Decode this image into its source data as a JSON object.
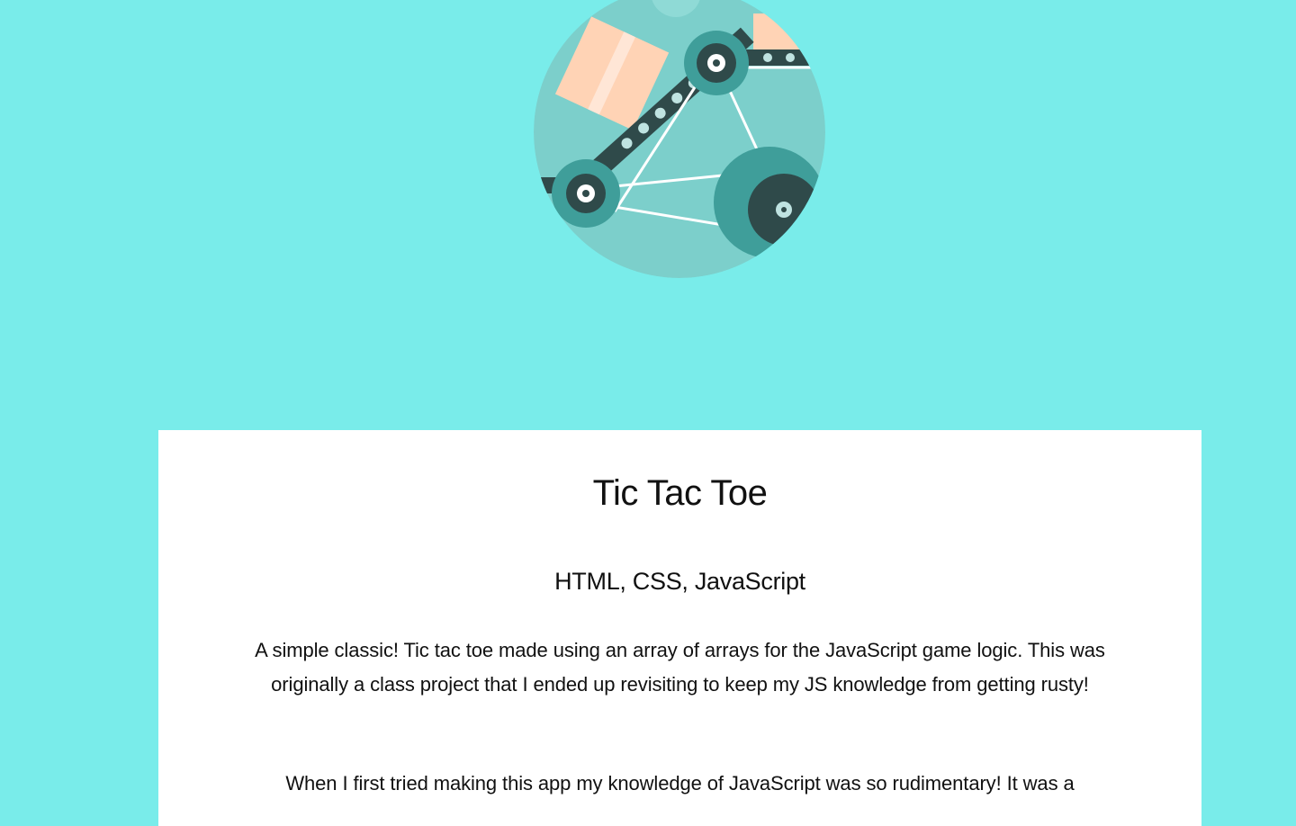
{
  "project": {
    "title": "Tic Tac Toe",
    "technologies": "HTML, CSS, JavaScript",
    "paragraphs": [
      "A simple classic! Tic tac toe made using an array of arrays for the JavaScript game logic. This was originally a class project that I ended up revisiting to keep my JS knowledge from getting rusty!",
      "When I first tried making this app my knowledge of JavaScript was so rudimentary! It was a"
    ]
  },
  "colors": {
    "page_background": "#79ecea",
    "card_background": "#ffffff",
    "text": "#111111",
    "illustration_bg": "#7ccfcb",
    "gear_teal": "#3f9e9a",
    "gear_dark": "#2f4a4a",
    "box_peach": "#ffd3b5"
  },
  "icons": {
    "hero": "gears-conveyor-illustration"
  }
}
